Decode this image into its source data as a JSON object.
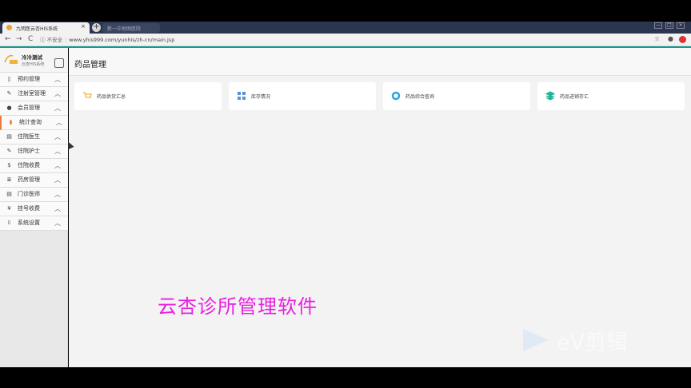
{
  "browser": {
    "active_tab_title": "九明医云杏HIS系统",
    "inactive_tab_title": "新一中地图医院",
    "new_tab": "+",
    "tab_close": "×",
    "security_label": "不安全",
    "url": "www.yhis999.com/yunhis/zh-cn/main.jsp",
    "back": "←",
    "forward": "→",
    "reload": "C",
    "info": "ⓘ",
    "star": "☆",
    "account": "●",
    "menu": "⋮",
    "minimize": "—",
    "maximize": "□",
    "close": "×"
  },
  "app": {
    "logo_title": "冷冷测试",
    "logo_subtitle": "云杏HIS系统",
    "page_title": "药品管理",
    "collapse": "‹",
    "menu": [
      {
        "label": "预约管理",
        "icon": "phone-icon",
        "glyph": "▯",
        "chevron": "︿"
      },
      {
        "label": "注射室管理",
        "icon": "syringe-icon",
        "glyph": "✎",
        "chevron": "︿"
      },
      {
        "label": "会员管理",
        "icon": "user-icon",
        "glyph": "●",
        "chevron": "︿"
      },
      {
        "label": "统计查询",
        "icon": "bar-chart-icon",
        "glyph": "▮",
        "chevron": "︿"
      },
      {
        "label": "住院医生",
        "icon": "doctor-icon",
        "glyph": "▤",
        "chevron": "︿"
      },
      {
        "label": "住院护士",
        "icon": "nurse-icon",
        "glyph": "✎",
        "chevron": "︿"
      },
      {
        "label": "住院收费",
        "icon": "dollar-icon",
        "glyph": "$",
        "chevron": "︿"
      },
      {
        "label": "药房管理",
        "icon": "list-icon",
        "glyph": "≣",
        "chevron": "︿"
      },
      {
        "label": "门诊医师",
        "icon": "calendar-icon",
        "glyph": "▤",
        "chevron": "︿"
      },
      {
        "label": "挂号收费",
        "icon": "yen-icon",
        "glyph": "¥",
        "chevron": "︿"
      },
      {
        "label": "系统设置",
        "icon": "grid-icon",
        "glyph": "⁞⁞",
        "chevron": "︿"
      }
    ],
    "cards": [
      {
        "label": "药品供货汇总",
        "icon": "cart-icon",
        "color": "#f0b33a"
      },
      {
        "label": "库存情况",
        "icon": "tiles-icon",
        "color": "#5b8fd9"
      },
      {
        "label": "药品综合查询",
        "icon": "lifebuoy-icon",
        "color": "#2aa6d9"
      },
      {
        "label": "药品进销存汇",
        "icon": "layers-icon",
        "color": "#1fb596"
      }
    ]
  },
  "overlay": {
    "caption": "云杏诊所管理软件",
    "watermark": "eV剪辑"
  },
  "colors": {
    "accent_teal": "#169a8c",
    "active_menu": "#f07a3a",
    "caption": "#e820e0"
  }
}
